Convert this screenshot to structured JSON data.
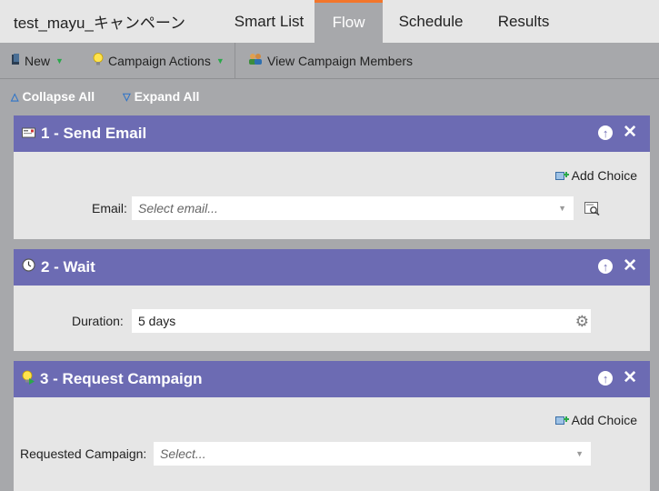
{
  "tabs": {
    "campaign_name": "test_mayu_キャンペーン",
    "smart_list": "Smart List",
    "flow": "Flow",
    "schedule": "Schedule",
    "results": "Results"
  },
  "toolbar": {
    "new_label": "New",
    "campaign_actions_label": "Campaign Actions",
    "view_members_label": "View Campaign Members"
  },
  "collapsebar": {
    "collapse_label": "Collapse All",
    "expand_label": "Expand All"
  },
  "steps": [
    {
      "title": "1 - Send Email",
      "add_choice": "Add Choice",
      "field_label": "Email:",
      "field_placeholder": "Select email..."
    },
    {
      "title": "2 - Wait",
      "field_label": "Duration:",
      "field_value": "5 days"
    },
    {
      "title": "3 - Request Campaign",
      "add_choice": "Add Choice",
      "field_label": "Requested Campaign:",
      "field_placeholder": "Select..."
    }
  ],
  "colors": {
    "step_header": "#6c6bb3",
    "active_tab_accent": "#f3762b",
    "panel_bg": "#e6e6e6",
    "canvas_bg": "#a7a8ab"
  }
}
